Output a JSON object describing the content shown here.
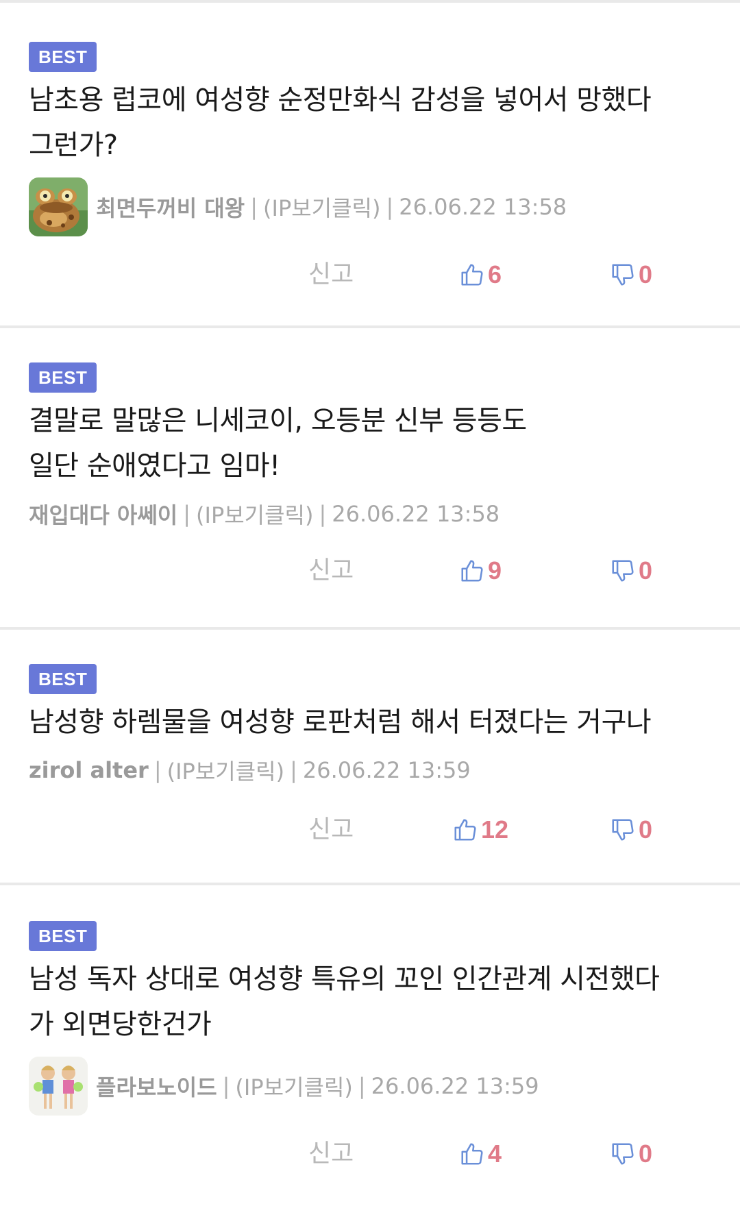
{
  "comments": [
    {
      "badge": "BEST",
      "text": "남초용 럽코에 여성향 순정만화식 감성을 넣어서 망했다\n그런가?",
      "author": "최면두꺼비 대왕",
      "ip_label": "(IP보기클릭)",
      "datetime": "26.06.22 13:58",
      "report_label": "신고",
      "upvotes": "6",
      "downvotes": "0",
      "avatar_icon": "toad-avatar-icon"
    },
    {
      "badge": "BEST",
      "text": "결말로 말많은 니세코이, 오등분 신부 등등도\n일단 순애였다고 임마!",
      "author": "재입대다 아쎄이",
      "ip_label": "(IP보기클릭)",
      "datetime": "26.06.22 13:58",
      "report_label": "신고",
      "upvotes": "9",
      "downvotes": "0"
    },
    {
      "badge": "BEST",
      "text": "남성향 하렘물을 여성향 로판처럼 해서 터졌다는 거구나",
      "author": "zirol alter",
      "ip_label": "(IP보기클릭)",
      "datetime": "26.06.22 13:59",
      "report_label": "신고",
      "upvotes": "12",
      "downvotes": "0"
    },
    {
      "badge": "BEST",
      "text": "남성 독자 상대로 여성향 특유의 꼬인 인간관계 시전했다\n가 외면당한건가",
      "author": "플라보노이드",
      "ip_label": "(IP보기클릭)",
      "datetime": "26.06.22 13:59",
      "report_label": "신고",
      "upvotes": "4",
      "downvotes": "0",
      "avatar_icon": "cheerleaders-avatar-icon"
    }
  ],
  "colors": {
    "badge_bg": "#6878d8",
    "thumb_icon": "#6a8fd8",
    "count": "#e07a88",
    "meta_text": "#9a9a9a",
    "divider": "#e9e9e9"
  }
}
